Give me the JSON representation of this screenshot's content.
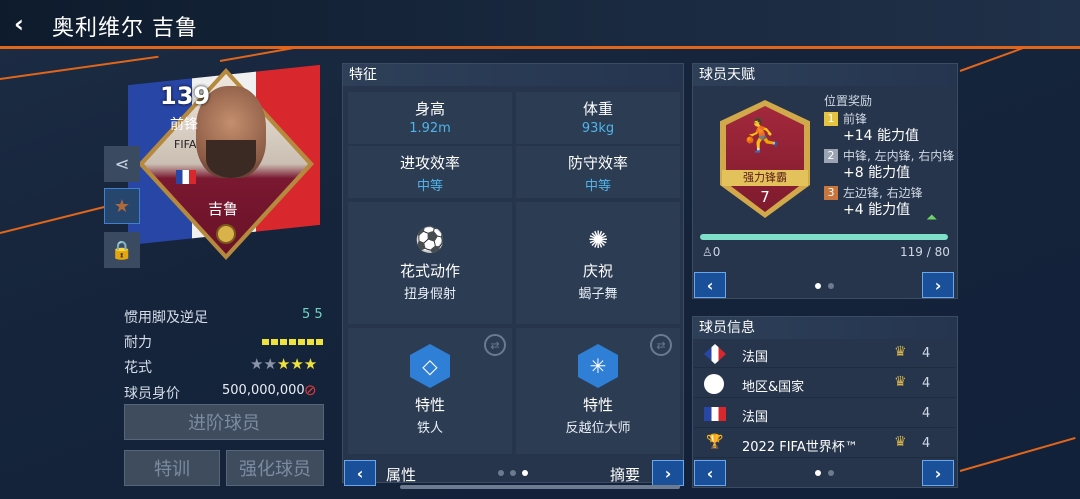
{
  "header": {
    "back_icon": "‹",
    "title": "奥利维尔 吉鲁"
  },
  "card": {
    "rating": "139",
    "position": "前锋",
    "name": "吉鲁",
    "event": "FIFA"
  },
  "side_buttons": [
    {
      "icon": "share-icon"
    },
    {
      "icon": "star-icon"
    },
    {
      "icon": "lock-icon"
    }
  ],
  "player_stats": {
    "foot_label": "惯用脚及逆足",
    "foot_value": "5 5",
    "stamina_label": "耐力",
    "skill_label": "花式",
    "skill_stars": 3,
    "skill_stars_max": 5,
    "value_label": "球员身价",
    "value": "500,000,000"
  },
  "actions": {
    "advance": "进阶球员",
    "train": "特训",
    "enhance": "强化球员"
  },
  "traits_panel": {
    "title": "特征",
    "height_label": "身高",
    "height": "1.92m",
    "weight_label": "体重",
    "weight": "93kg",
    "attack_label": "进攻效率",
    "attack": "中等",
    "defense_label": "防守效率",
    "defense": "中等",
    "skill_move_label": "花式动作",
    "skill_move": "扭身假射",
    "celebration_label": "庆祝",
    "celebration": "蝎子舞",
    "trait1_label": "特性",
    "trait1": "铁人",
    "trait2_label": "特性",
    "trait2": "反越位大师",
    "nav_left": "属性",
    "nav_right": "摘要"
  },
  "talent_panel": {
    "title": "球员天赋",
    "badge_label": "强力锋霸",
    "badge_level": "7",
    "bonus_title": "位置奖励",
    "bonuses": [
      {
        "num": "1",
        "pos": "前锋",
        "val": "+14 能力值",
        "color": "#e6c33e"
      },
      {
        "num": "2",
        "pos": "中锋, 左内锋, 右内锋",
        "val": "+8 能力值",
        "color": "#9aa4b2"
      },
      {
        "num": "3",
        "pos": "左边锋, 右边锋",
        "val": "+4 能力值",
        "color": "#c8763e"
      }
    ],
    "progress_left": "0",
    "progress_right": "119 / 80",
    "progress_fraction": 1.0
  },
  "info_panel": {
    "title": "球员信息",
    "rows": [
      {
        "text": "法国",
        "level": "4"
      },
      {
        "text": "地区&国家",
        "level": "4"
      },
      {
        "text": "法国",
        "level": "4"
      },
      {
        "text": "2022 FIFA世界杯™",
        "level": "4"
      }
    ]
  }
}
